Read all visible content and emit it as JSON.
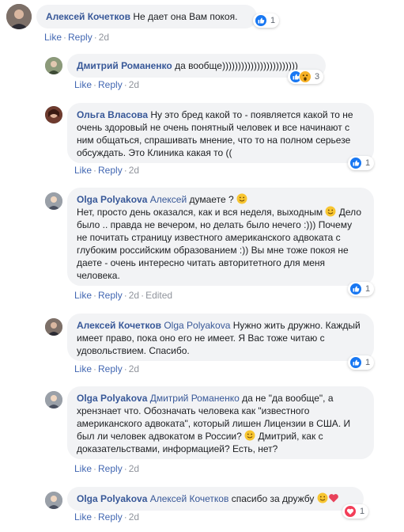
{
  "actions": {
    "like": "Like",
    "reply": "Reply",
    "sep": "·",
    "edited": "Edited"
  },
  "colors": {
    "author": "#385898",
    "link": "#4267b2",
    "bubble": "#f2f3f5",
    "like": "#1877f2",
    "love": "#f33e58",
    "wow": "#f7b125"
  },
  "comments": [
    {
      "author": "Алексей Кочетков",
      "text": "Не дает она Вам покоя.",
      "time": "2d",
      "reactions": {
        "icons": [
          "like-icon"
        ],
        "count": "1"
      }
    },
    {
      "author": "Дмитрий Романенко",
      "text": "да вообще))))))))))))))))))))))))",
      "time": "2d",
      "reactions": {
        "icons": [
          "like-icon",
          "wow-icon"
        ],
        "count": "3"
      }
    },
    {
      "author": "Ольга Власова",
      "text": "Ну это бред какой то - появляется какой то не очень здоровый не очень понятный человек и все начинают с ним общаться, спрашивать мнение, что то на полном серьезе обсуждать. Это Клиника какая то ((",
      "time": "2d",
      "reactions": {
        "icons": [
          "like-icon"
        ],
        "count": "1"
      }
    },
    {
      "author": "Olga Polyakova",
      "mention": "Алексей",
      "text1": "думаете ?",
      "text2": "Нет, просто день оказался, как и вся неделя, выходным",
      "text3": "Дело было .. правда не вечером, но делать было нечего :))) Почему не почитать страницу известного американского адвоката с глубоким российским образованием :)) Вы мне тоже покоя не даете - очень интересно читать авторитетного для меня человека.",
      "time": "2d",
      "edited": "Edited",
      "reactions": {
        "icons": [
          "like-icon"
        ],
        "count": "1"
      }
    },
    {
      "author": "Алексей Кочетков",
      "mention": "Olga Polyakova",
      "text": "Нужно жить дружно. Каждый имеет право, пока оно его не имеет. Я Вас тоже читаю с удовольствием. Спасибо.",
      "time": "2d",
      "reactions": {
        "icons": [
          "like-icon"
        ],
        "count": "1"
      }
    },
    {
      "author": "Olga Polyakova",
      "mention": "Дмитрий Романенко",
      "text1": "да не \"да вообще\", а хрензнает что. Обозначать человека как \"известного американского адвоката\", который лишен Лицензии в США. И был ли человек адвокатом в России?",
      "text2": "Дмитрий, как с доказательствами, информацией? Есть, нет?",
      "time": "2d",
      "reactions": null
    },
    {
      "author": "Olga Polyakova",
      "mention": "Алексей Кочетков",
      "text": "спасибо за дружбу",
      "time": "2d",
      "reactions": {
        "icons": [
          "love-icon"
        ],
        "count": "1"
      }
    }
  ]
}
